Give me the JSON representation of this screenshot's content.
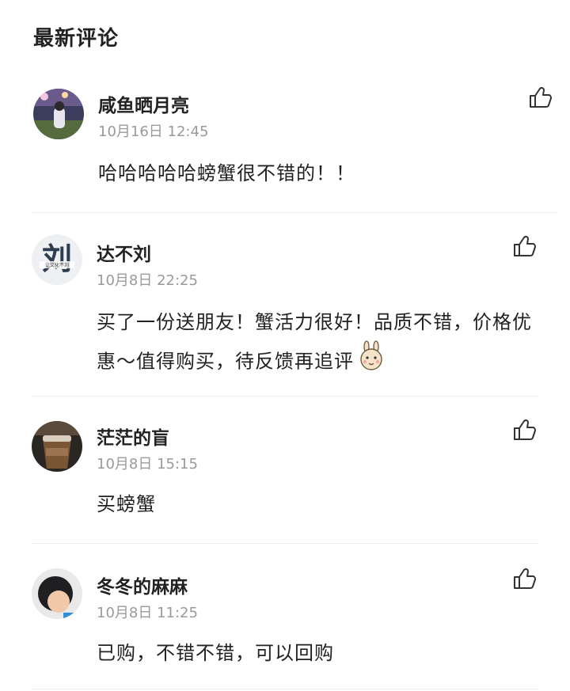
{
  "header": {
    "title": "最新评论"
  },
  "comments": [
    {
      "user": "咸鱼晒月亮",
      "time": "10月16日 12:45",
      "text": "哈哈哈哈哈螃蟹很不错的！！"
    },
    {
      "user": "达不刘",
      "time": "10月8日 22:25",
      "text": "买了一份送朋友！蟹活力很好！品质不错，价格优惠～值得购买，待反馈再追评",
      "avatar_text": "刘",
      "avatar_sub": "让文化不刘"
    },
    {
      "user": "茫茫的盲",
      "time": "10月8日 15:15",
      "text": "买螃蟹"
    },
    {
      "user": "冬冬的麻麻",
      "time": "10月8日 11:25",
      "text": "已购，不错不错，可以回购"
    }
  ],
  "icons": {
    "like": "thumbs-up-icon",
    "emoji": "bunny-face-emoji-icon"
  }
}
